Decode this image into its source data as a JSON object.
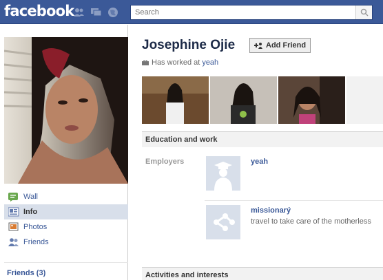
{
  "topbar": {
    "logo_text": "facebook",
    "search": {
      "placeholder": "Search"
    },
    "colors": {
      "bar": "#3b5998"
    }
  },
  "sidebar": {
    "nav_items": [
      {
        "label": "Wall",
        "icon": "wall-icon",
        "active": false
      },
      {
        "label": "Info",
        "icon": "info-icon",
        "active": true
      },
      {
        "label": "Photos",
        "icon": "photos-icon",
        "active": false
      },
      {
        "label": "Friends",
        "icon": "friends-icon",
        "active": false
      }
    ],
    "friends_count_label": "Friends (3)"
  },
  "profile": {
    "name": "Josephine Ojie",
    "add_friend_label": "Add Friend",
    "worked_prefix": "Has worked at",
    "worked_link": "yeah"
  },
  "sections": {
    "education_title": "Education and work",
    "employers_label": "Employers",
    "employers": [
      {
        "name": "yeah",
        "description": "",
        "icon": "graduate-icon"
      },
      {
        "name": "missionarý",
        "description": "travel to take care of the motherless",
        "icon": "network-icon"
      }
    ],
    "activities_title": "Activities and interests"
  }
}
